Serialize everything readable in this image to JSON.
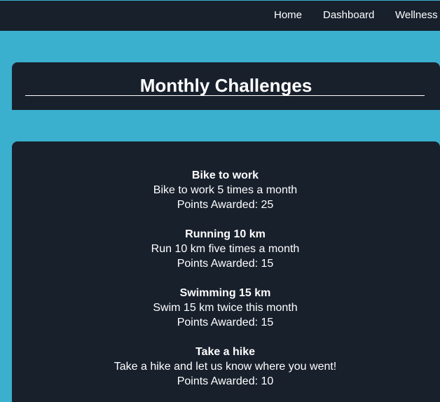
{
  "nav": {
    "items": [
      {
        "label": "Home"
      },
      {
        "label": "Dashboard"
      },
      {
        "label": "Wellness"
      }
    ]
  },
  "header": {
    "title": "Monthly Challenges"
  },
  "challenges": [
    {
      "name": "Bike to work",
      "description": "Bike to work 5 times a month",
      "points": "Points Awarded: 25"
    },
    {
      "name": "Running 10 km",
      "description": "Run 10 km five times a month",
      "points": "Points Awarded: 15"
    },
    {
      "name": "Swimming 15 km",
      "description": "Swim 15 km twice this month",
      "points": "Points Awarded: 15"
    },
    {
      "name": "Take a hike",
      "description": "Take a hike and let us know where you went!",
      "points": "Points Awarded: 10"
    }
  ]
}
